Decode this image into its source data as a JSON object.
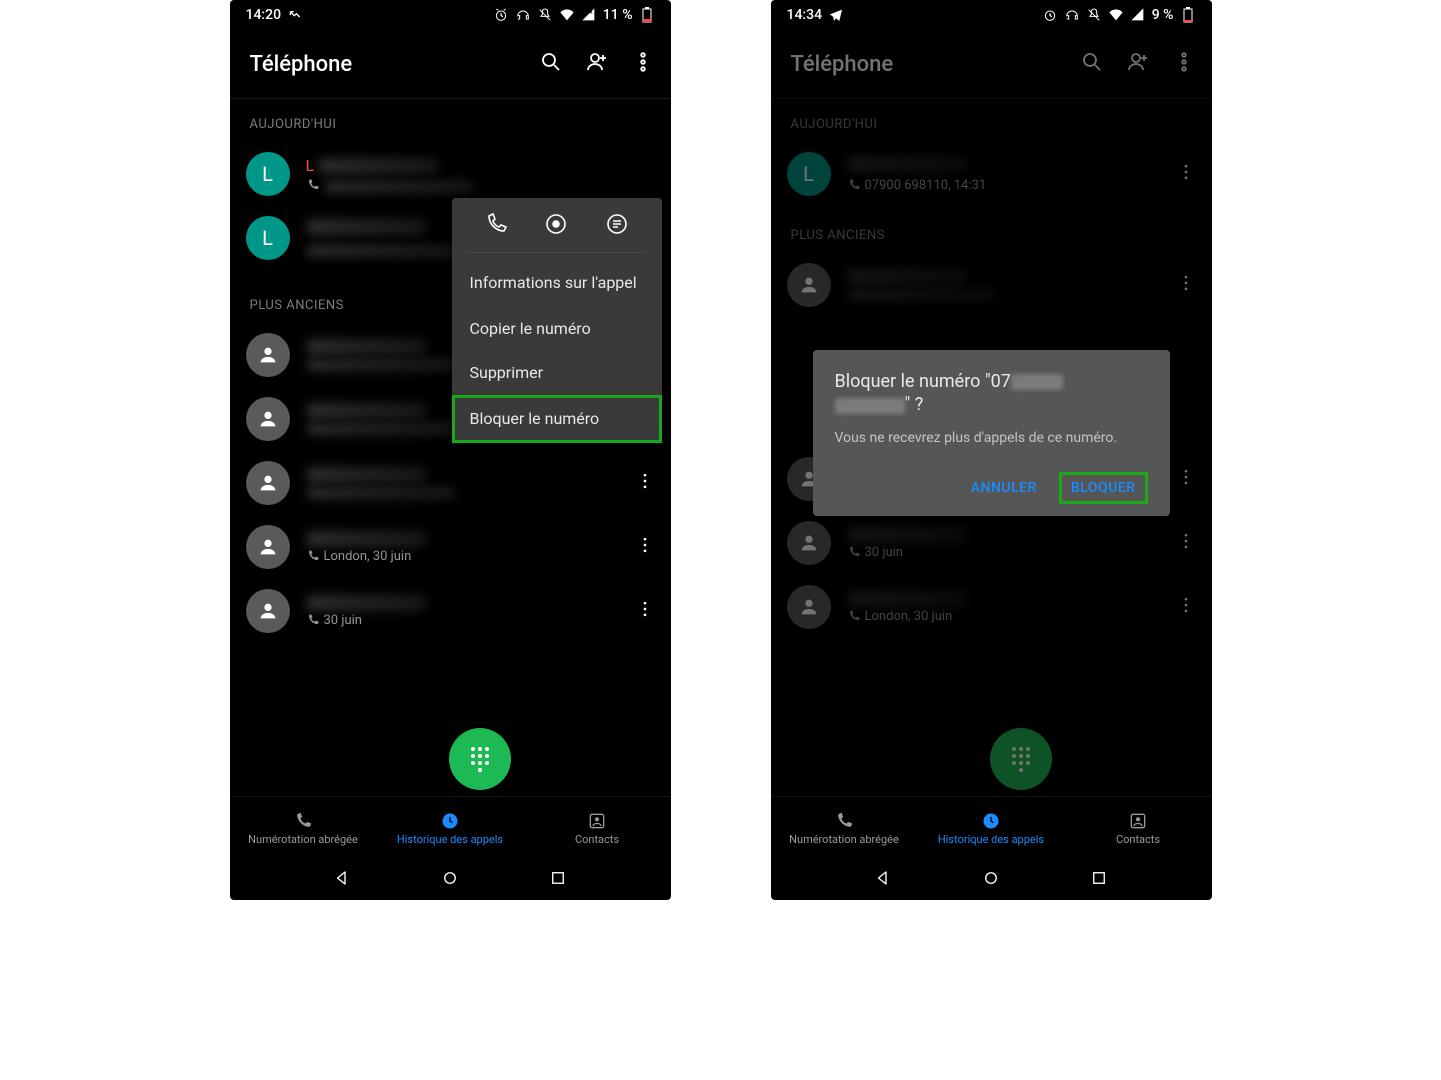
{
  "phones": {
    "left": {
      "status": {
        "time": "14:20",
        "battery": "11 %"
      },
      "header": {
        "title": "Téléphone"
      },
      "sections": {
        "today": "AUJOURD'HUI",
        "older": "PLUS ANCIENS"
      },
      "calls": {
        "today0": {
          "initial": "L",
          "name": "L",
          "meta": ""
        },
        "today1": {
          "initial": "L",
          "name": "",
          "meta": ""
        },
        "older2": {
          "name": "",
          "meta": "London, 30 juin"
        },
        "older3": {
          "name": "",
          "meta": "30 juin"
        }
      },
      "ctx": {
        "info": "Informations sur l'appel",
        "copy": "Copier le numéro",
        "delete": "Supprimer",
        "block": "Bloquer le numéro"
      }
    },
    "right": {
      "status": {
        "time": "14:34",
        "battery": "9 %"
      },
      "header": {
        "title": "Téléphone"
      },
      "sections": {
        "today": "AUJOURD'HUI",
        "older": "PLUS ANCIENS"
      },
      "calls": {
        "today0": {
          "initial": "L",
          "name": "",
          "meta": "07900 698110, 14:31"
        },
        "older0": {
          "name": "",
          "meta": "30 juin"
        },
        "older1": {
          "name": "",
          "meta": "London, 30 juin"
        }
      },
      "dialog": {
        "title_pre": "Bloquer le numéro \"07",
        "title_post": "\" ?",
        "body": "Vous ne recevrez plus d'appels de ce numéro.",
        "cancel": "ANNULER",
        "confirm": "BLOQUER"
      }
    }
  },
  "nav": {
    "dial": "Numérotation abrégée",
    "history": "Historique des appels",
    "contacts": "Contacts"
  }
}
